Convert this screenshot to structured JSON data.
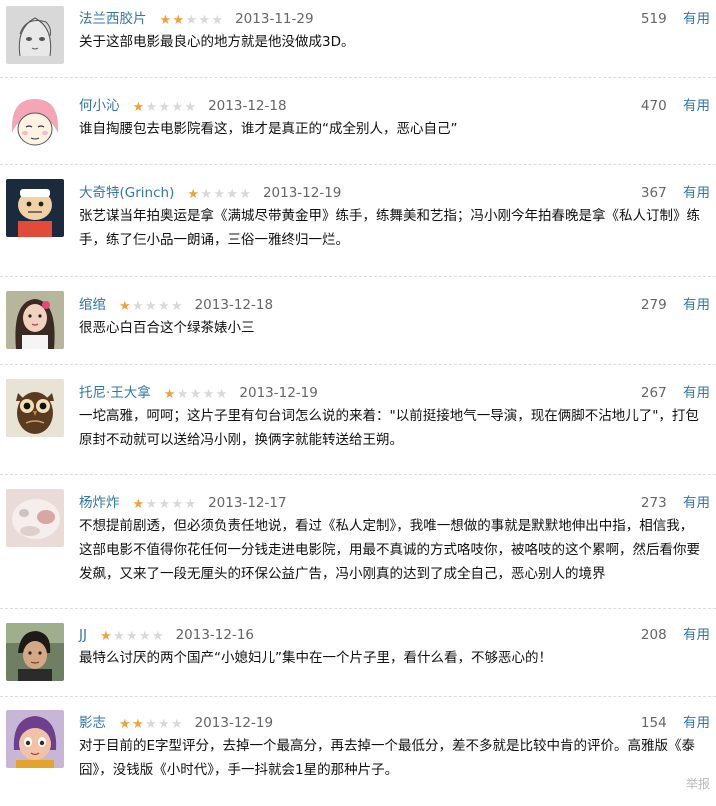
{
  "colors": {
    "link": "#3377aa",
    "star_on": "#f1a13a",
    "star_off": "#d9d9d9",
    "meta": "#666666",
    "divider": "#dddddd"
  },
  "icons": {
    "star": "★",
    "vote_label_icon": "thumb-icon"
  },
  "comments": [
    {
      "author": "法兰西胶片",
      "rating": 2,
      "date": "2013-11-29",
      "votes": "519",
      "useful": "有用",
      "text": "关于这部电影最良心的地方就是他没做成3D。",
      "avatar": "sketch-face-avatar"
    },
    {
      "author": "何小沁",
      "rating": 1,
      "date": "2013-12-18",
      "votes": "470",
      "useful": "有用",
      "text": "谁自掏腰包去电影院看这，谁才是真正的“成全别人，恶心自己”",
      "avatar": "pink-hair-cartoon-avatar"
    },
    {
      "author": "大奇特(Grinch)",
      "rating": 1,
      "date": "2013-12-19",
      "votes": "367",
      "useful": "有用",
      "text": "张艺谋当年拍奥运是拿《满城尽带黄金甲》练手，练舞美和艺指；冯小刚今年拍春晚是拿《私人订制》练手，练了仨小品一朗诵，三俗一雅终归一烂。",
      "avatar": "cartoon-character-avatar"
    },
    {
      "author": "绾绾",
      "rating": 1,
      "date": "2013-12-18",
      "votes": "279",
      "useful": "有用",
      "text": "很恶心白百合这个绿茶婊小三",
      "avatar": "girl-photo-avatar"
    },
    {
      "author": "托尼·王大拿",
      "rating": 1,
      "date": "2013-12-19",
      "votes": "267",
      "useful": "有用",
      "text": "一坨高雅，呵呵；这片子里有句台词怎么说的来着：\"以前挺接地气一导演，现在俩脚不沾地儿了\"，打包原封不动就可以送给冯小刚，换俩字就能转送给王朔。",
      "avatar": "owl-avatar"
    },
    {
      "author": "杨炸炸",
      "rating": 1,
      "date": "2013-12-17",
      "votes": "273",
      "useful": "有用",
      "text": "不想提前剧透，但必须负责任地说，看过《私人定制》，我唯一想做的事就是默默地伸出中指，相信我，这部电影不值得你花任何一分钱走进电影院，用最不真诚的方式咯吱你，被咯吱的这个累啊，然后看你要发飙，又来了一段无厘头的环保公益广告，冯小刚真的达到了成全自己，恶心别人的境界",
      "avatar": "blurry-animal-avatar"
    },
    {
      "author": "JJ",
      "rating": 1,
      "date": "2013-12-16",
      "votes": "208",
      "useful": "有用",
      "text": "最特么讨厌的两个国产“小媳妇儿”集中在一个片子里，看什么看，不够恶心的！",
      "avatar": "man-photo-avatar"
    },
    {
      "author": "影志",
      "rating": 2,
      "date": "2013-12-19",
      "votes": "154",
      "useful": "有用",
      "text": "对于目前的E字型评分，去掉一个最高分，再去掉一个最低分，差不多就是比较中肯的评价。高雅版《泰囧》，没钱版《小时代》，手一抖就会1星的那种片子。",
      "avatar": "animated-girl-avatar"
    }
  ],
  "footer": {
    "report": "举报"
  }
}
